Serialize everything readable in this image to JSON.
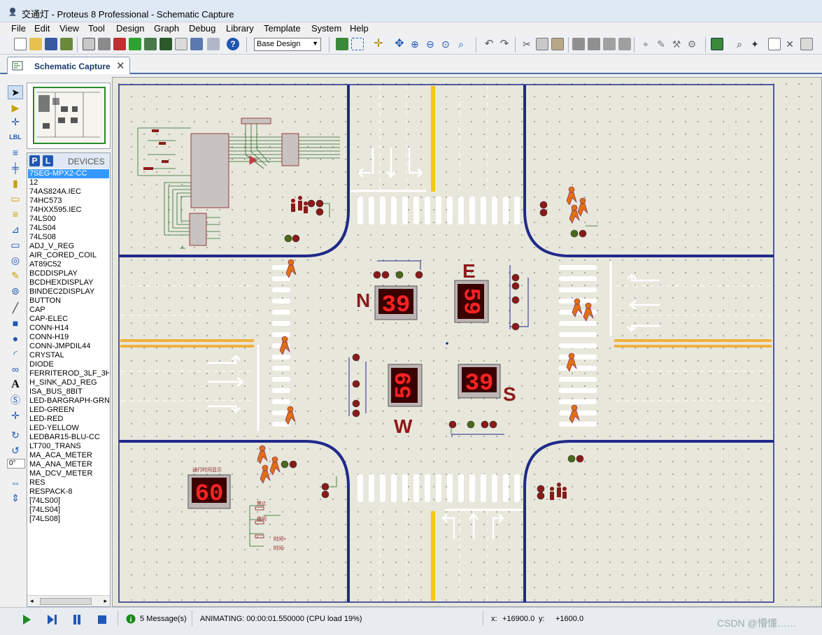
{
  "window": {
    "title": "交通灯 - Proteus 8 Professional - Schematic Capture"
  },
  "menu": [
    "File",
    "Edit",
    "View",
    "Tool",
    "Design",
    "Graph",
    "Debug",
    "Library",
    "Template",
    "System",
    "Help"
  ],
  "toolbar": {
    "design_select": "Base Design"
  },
  "tab": {
    "label": "Schematic Capture"
  },
  "devices": {
    "header": "DEVICES",
    "p_btn": "P",
    "l_btn": "L",
    "selected": "7SEG-MPX2-CC",
    "items": [
      "7SEG-MPX2-CC",
      "12",
      "74AS824A.IEC",
      "74HC573",
      "74HXX595.IEC",
      "74LS00",
      "74LS04",
      "74LS08",
      "ADJ_V_REG",
      "AIR_CORED_COIL",
      "AT89C52",
      "BCDDISPLAY",
      "BCDHEXDISPLAY",
      "BINDEC2DISPLAY",
      "BUTTON",
      "CAP",
      "CAP-ELEC",
      "CONN-H14",
      "CONN-H19",
      "CONN-JMPDIL44",
      "CRYSTAL",
      "DIODE",
      "FERRITEROD_3LF_3H",
      "H_SINK_ADJ_REG",
      "ISA_BUS_8BIT",
      "LED-BARGRAPH-GRN",
      "LED-GREEN",
      "LED-RED",
      "LED-YELLOW",
      "LEDBAR15-BLU-CC",
      "LT700_TRANS",
      "MA_ACA_METER",
      "MA_ANA_METER",
      "MA_DCV_METER",
      "RES",
      "RESPACK-8",
      "[74LS00]",
      "[74LS04]",
      "[74LS08]"
    ]
  },
  "rotation": {
    "angle": "0°"
  },
  "schematic": {
    "direction_labels": {
      "north": "N",
      "east": "E",
      "west": "W",
      "south": "S"
    },
    "displays": {
      "north": "39",
      "east": "59",
      "west": "59",
      "south": "39",
      "pedestrian": "60"
    },
    "ped_display_title": "通行时间显示",
    "button_labels": [
      "禁止",
      "夜间",
      "时间+",
      "时间-"
    ]
  },
  "status": {
    "messages": "5 Message(s)",
    "animating": "ANIMATING: 00:00:01.550000 (CPU load 19%)",
    "x_label": "x:",
    "x_value": "+16900.0",
    "y_label": "y:",
    "y_value": "+1600.0"
  },
  "watermark": "CSDN @懵懂……",
  "colors": {
    "road_edge": "#1f2a8a",
    "center_line": "#f0b040",
    "stop_line": "#f5c518",
    "segment_on": "#ff2222",
    "segment_bg": "#3a0000",
    "label_red": "#8b1a1a",
    "selection": "#3399ff"
  }
}
